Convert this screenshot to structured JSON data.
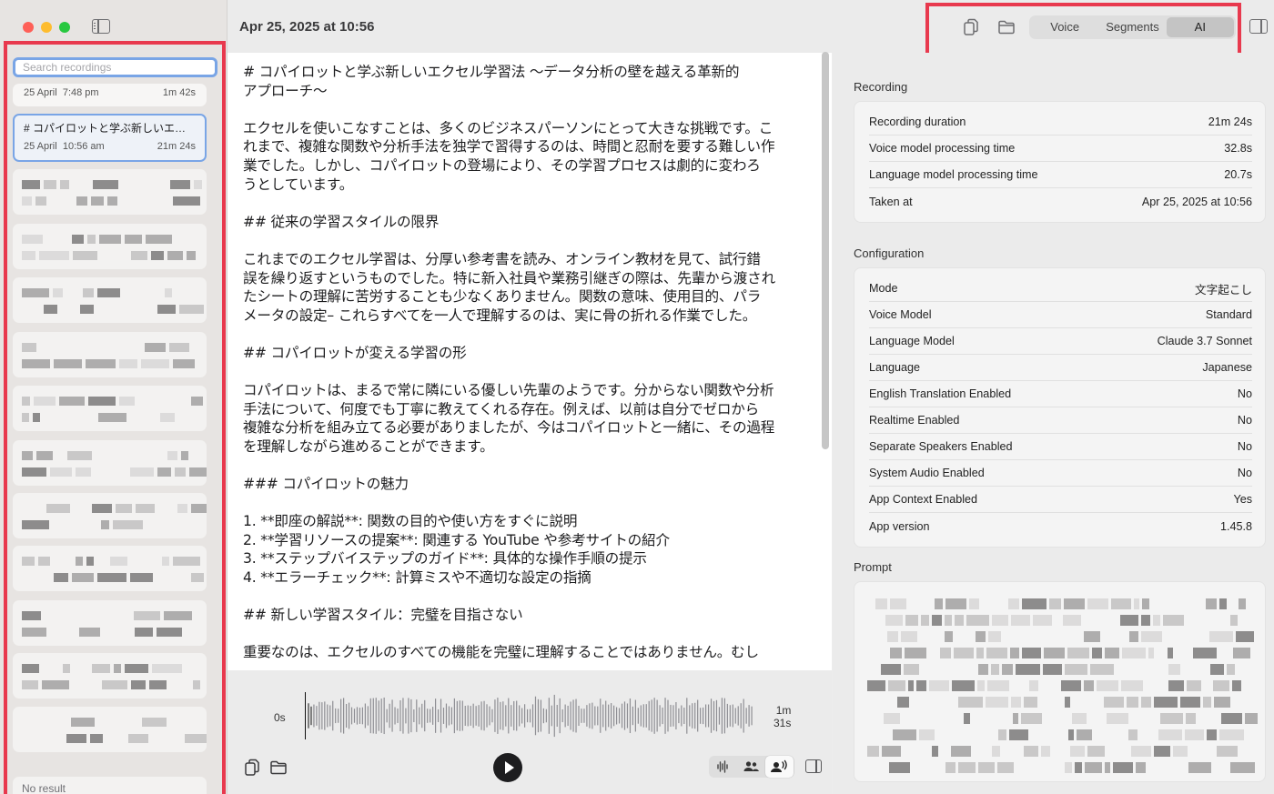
{
  "sidebar": {
    "search_placeholder": "Search recordings",
    "recordings": [
      {
        "date": "25 April",
        "time": "7:48 pm",
        "duration": "1m 42s"
      },
      {
        "title": "# コパイロットと学ぶ新しいエク…",
        "date": "25 April",
        "time": "10:56 am",
        "duration": "21m 24s",
        "selected": true
      }
    ],
    "no_result": "No result"
  },
  "header": {
    "date_title": "Apr 25, 2025 at 10:56",
    "tabs": [
      "Voice",
      "Segments",
      "AI"
    ],
    "active_tab": "AI"
  },
  "document": {
    "text": "# コパイロットと学ぶ新しいエクセル学習法 ～データ分析の壁を越える革新的\nアプローチ～\n\nエクセルを使いこなすことは、多くのビジネスパーソンにとって大きな挑戦です。こ\nれまで、複雑な関数や分析手法を独学で習得するのは、時間と忍耐を要する難しい作\n業でした。しかし、コパイロットの登場により、その学習プロセスは劇的に変わろ\nうとしています。\n\n## 従来の学習スタイルの限界\n\nこれまでのエクセル学習は、分厚い参考書を読み、オンライン教材を見て、試行錯\n誤を繰り返すというものでした。特に新入社員や業務引継ぎの際は、先輩から渡され\nたシートの理解に苦労することも少なくありません。関数の意味、使用目的、パラ\nメータの設定– これらすべてを一人で理解するのは、実に骨の折れる作業でした。\n\n## コパイロットが変える学習の形\n\nコパイロットは、まるで常に隣にいる優しい先輩のようです。分からない関数や分析\n手法について、何度でも丁寧に教えてくれる存在。例えば、以前は自分でゼロから\n複雑な分析を組み立てる必要がありましたが、今はコパイロットと一緒に、その過程\nを理解しながら進めることができます。\n\n### コパイロットの魅力\n\n1. **即座の解説**: 関数の目的や使い方をすぐに説明\n2. **学習リソースの提案**: 関連する YouTube や参考サイトの紹介\n3. **ステップバイステップのガイド**: 具体的な操作手順の提示\n4. **エラーチェック**: 計算ミスや不適切な設定の指摘\n\n## 新しい学習スタイル：完璧を目指さない\n\n重要なのは、エクセルのすべての機能を完璧に理解することではありません。むし"
  },
  "player": {
    "start_time": "0s",
    "end_time_line1": "1m",
    "end_time_line2": "31s",
    "progress": 0.0
  },
  "inspector": {
    "recording": {
      "title": "Recording",
      "rows": [
        {
          "label": "Recording duration",
          "value": "21m 24s"
        },
        {
          "label": "Voice model processing time",
          "value": "32.8s"
        },
        {
          "label": "Language model processing time",
          "value": "20.7s"
        },
        {
          "label": "Taken at",
          "value": "Apr 25, 2025 at 10:56"
        }
      ]
    },
    "configuration": {
      "title": "Configuration",
      "rows": [
        {
          "label": "Mode",
          "value": "文字起こし"
        },
        {
          "label": "Voice Model",
          "value": "Standard"
        },
        {
          "label": "Language Model",
          "value": "Claude 3.7 Sonnet"
        },
        {
          "label": "Language",
          "value": "Japanese"
        },
        {
          "label": "English Translation Enabled",
          "value": "No"
        },
        {
          "label": "Realtime Enabled",
          "value": "No"
        },
        {
          "label": "Separate Speakers Enabled",
          "value": "No"
        },
        {
          "label": "System Audio Enabled",
          "value": "No"
        },
        {
          "label": "App Context Enabled",
          "value": "Yes"
        },
        {
          "label": "App version",
          "value": "1.45.8"
        }
      ]
    },
    "prompt": {
      "title": "Prompt"
    }
  },
  "colors": {
    "highlight_frame": "#e8394e",
    "selection_border": "#79a5e6"
  }
}
